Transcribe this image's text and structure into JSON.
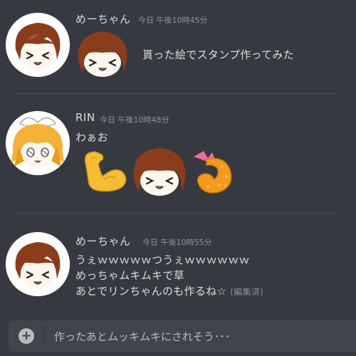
{
  "messages": [
    {
      "username": "めーちゃん",
      "timestamp": "今日 午後10時45分",
      "lines": [
        "貰った絵でスタンプ作ってみた"
      ]
    },
    {
      "username": "RIN",
      "timestamp": "今日 午後10時48分",
      "lines": [
        "わぁお"
      ]
    },
    {
      "username": "めーちゃん",
      "timestamp": "今日 午後10時55分",
      "lines": [
        "うぇｗｗｗｗｗつうぇｗｗｗｗｗｗ",
        "めっちゃムキムキで草",
        "あとでリンちゃんのも作るね☆"
      ],
      "edited": "(編集済)"
    }
  ],
  "input": {
    "value": "作ったあとムッキムキにされそう･･･",
    "plus_icon": "+"
  },
  "colors": {
    "background": "#36393f",
    "input_background": "#40444b",
    "text": "#dcddde",
    "muted": "#8e9297"
  }
}
